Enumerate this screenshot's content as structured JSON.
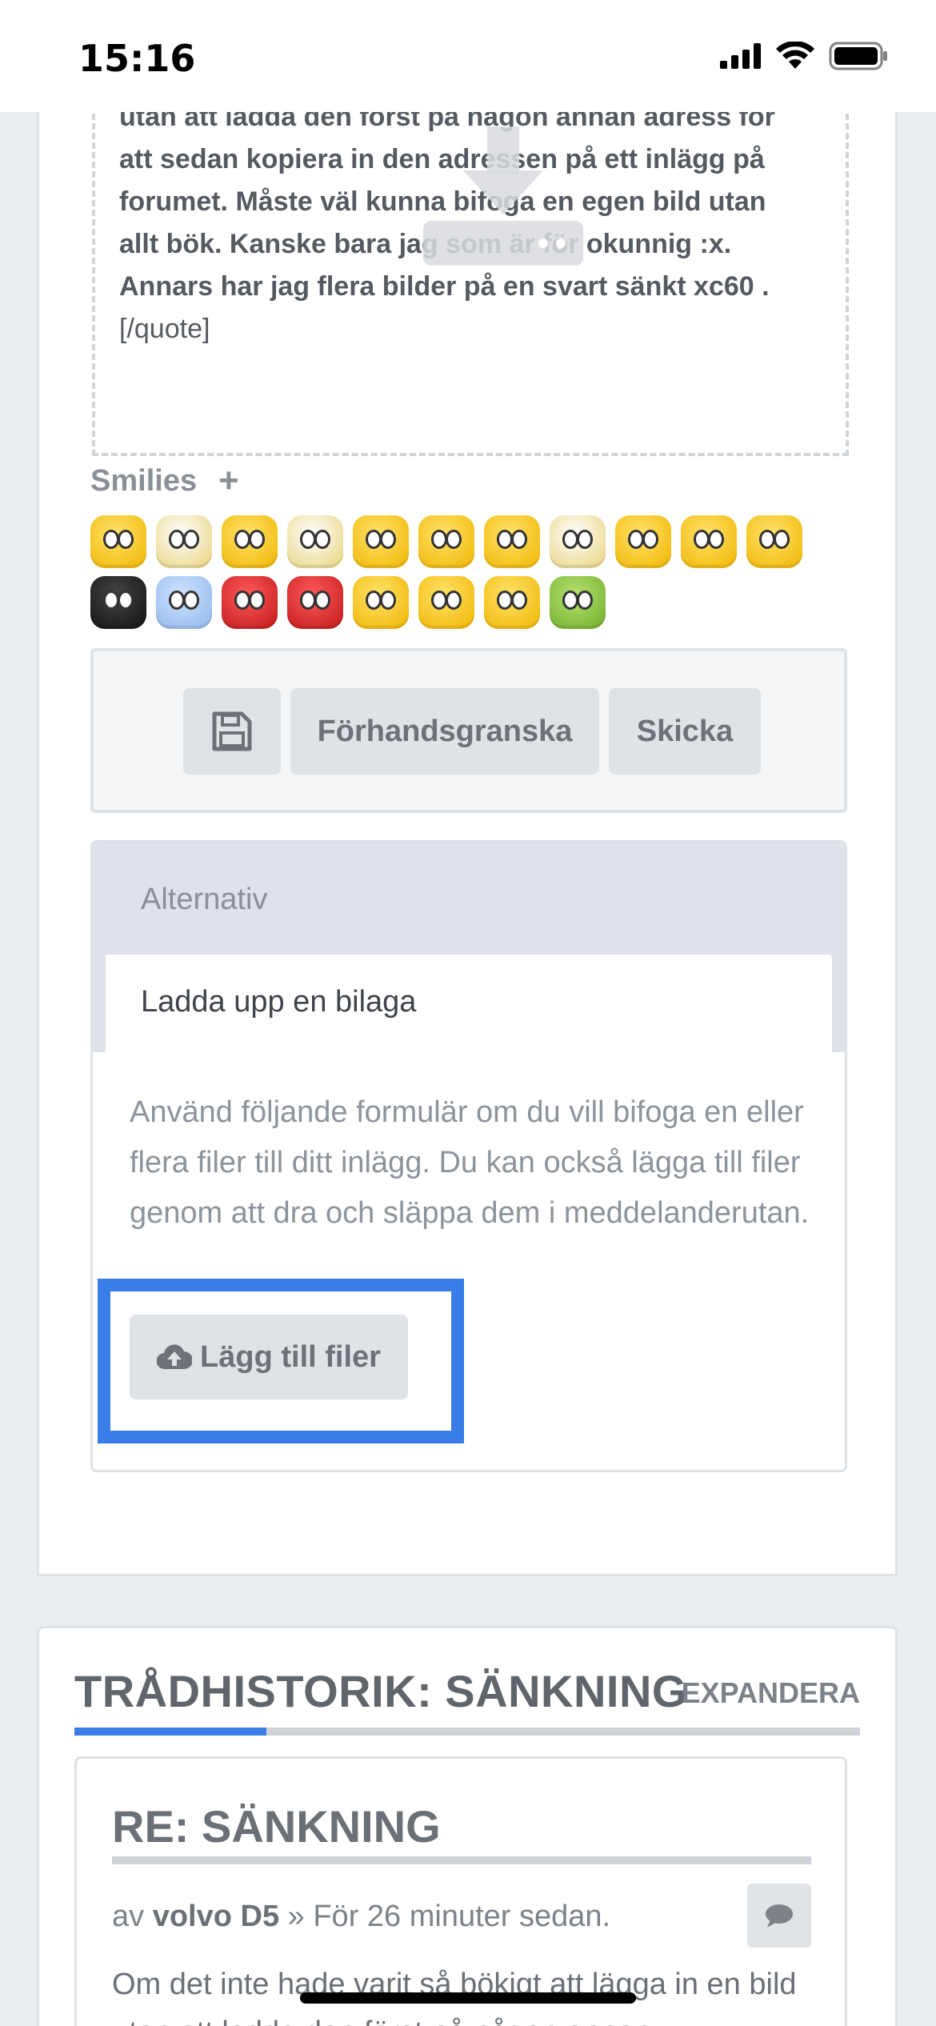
{
  "status_bar": {
    "time": "15:16"
  },
  "quote": {
    "lines": [
      "utan att ladda den först på någon annan adress för",
      "att sedan kopiera in den adressen på ett inlägg på",
      "forumet. Måste väl kunna bifoga en egen bild utan",
      "allt bök. Kanske bara jag som är för okunnig  :x.",
      "Annars har jag flera  bilder på en svart sänkt xc60 ."
    ],
    "close_tag": "[/quote]"
  },
  "smilies": {
    "label": "Smilies",
    "plus": "+"
  },
  "actions": {
    "save_icon": "floppy-disk-icon",
    "preview_label": "Förhandsgranska",
    "send_label": "Skicka"
  },
  "options": {
    "title": "Alternativ",
    "tab_label": "Ladda upp en bilaga",
    "description": "Använd följande formulär om du vill bifoga en eller flera filer till ditt inlägg. Du kan också lägga till filer genom att dra och släppa dem i meddelanderutan.",
    "upload_label": "Lägg till filer",
    "upload_icon": "cloud-upload-icon"
  },
  "history": {
    "title": "TRÅDHISTORIK: SÄNKNING",
    "expand_label": "EXPANDERA",
    "post": {
      "title": "RE: SÄNKNING",
      "meta_prefix": "av",
      "author": "volvo D5",
      "meta_suffix": "» För 26 minuter sedan.",
      "body": "Om det inte hade varit så bökigt att lägga in en bild utan att ladda den först på någon annan"
    }
  },
  "colors": {
    "accent": "#3b7de8",
    "button_bg": "#dfe2e6",
    "panel_header": "#dfe2e8"
  }
}
